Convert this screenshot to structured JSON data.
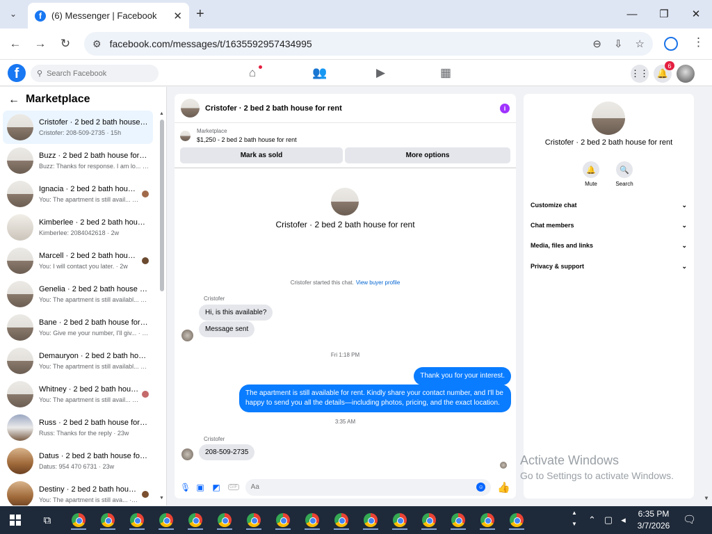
{
  "browser": {
    "tab_title": "(6) Messenger | Facebook",
    "url": "facebook.com/messages/t/1635592957434995",
    "new_tab": "+",
    "tab_close": "✕",
    "tab_search": "⌄",
    "window_min": "—",
    "window_restore": "❐",
    "window_close": "✕"
  },
  "facebook": {
    "search_placeholder": "Search Facebook",
    "notification_count": "6"
  },
  "left_panel": {
    "title": "Marketplace",
    "conversations": [
      {
        "name": "Cristofer · 2 bed 2 bath house f...",
        "preview": "Cristofer: 208-509-2735 · 15h"
      },
      {
        "name": "Buzz · 2 bed 2 bath house for r...",
        "preview": "Buzz: Thanks for response. I am lo... · 1w"
      },
      {
        "name": "Ignacia · 2 bed 2 bath house ...",
        "preview": "You: The apartment is still avail... · 1w"
      },
      {
        "name": "Kimberlee · 2 bed 2 bath house...",
        "preview": "Kimberlee: 2084042618 · 2w"
      },
      {
        "name": "Marcell · 2 bed 2 bath house ...",
        "preview": "You: I will contact you later. · 2w"
      },
      {
        "name": "Genelia · 2 bed 2 bath house fo...",
        "preview": "You: The apartment is still availabl... · 2w"
      },
      {
        "name": "Bane · 2 bed 2 bath house for r...",
        "preview": "You: Give me your number, I'll giv... · 4w"
      },
      {
        "name": "Demauryon · 2 bed 2 bath hou...",
        "preview": "You: The apartment is still availabl... · 4w"
      },
      {
        "name": "Whitney · 2 bed 2 bath hous...",
        "preview": "You: The apartment is still avail... · 4w"
      },
      {
        "name": "Russ · 2 bed 2 bath house for r...",
        "preview": "Russ: Thanks for the reply · 23w"
      },
      {
        "name": "Datus · 2 bed 2 bath house for ...",
        "preview": "Datus: 954 470 6731 · 23w"
      },
      {
        "name": "Destiny · 2 bed 2 bath house...",
        "preview": "You: The apartment is still ava... · 23w"
      }
    ]
  },
  "chat": {
    "title": "Cristofer · 2 bed 2 bath house for rent",
    "marketplace_label": "Marketplace",
    "listing": "$1,250 - 2 bed 2 bath house for rent",
    "mark_sold": "Mark as sold",
    "more_options": "More options",
    "started": "Cristofer started this chat.",
    "view_profile": "View buyer profile",
    "sender": "Cristofer",
    "msg1": "Hi, is this available?",
    "msg2": "Message sent",
    "stamp1": "Fri 1:18 PM",
    "out1": "Thank you for your interest.",
    "out2": "The apartment is still available for rent. Kindly share your contact number, and I'll be happy to send you all the details—including photos, pricing, and the exact location.",
    "stamp2": "3:35 AM",
    "msg3": "208-509-2735",
    "composer_placeholder": "Aa"
  },
  "right_panel": {
    "name": "Cristofer · 2 bed 2 bath house for rent",
    "mute": "Mute",
    "search": "Search",
    "sections": [
      "Customize chat",
      "Chat members",
      "Media, files and links",
      "Privacy & support"
    ]
  },
  "watermark": {
    "line1": "Activate Windows",
    "line2": "Go to Settings to activate Windows."
  },
  "taskbar": {
    "time": "6:35 PM",
    "date": "3/7/2026"
  },
  "colors": {
    "accent": "#1877f2",
    "outgoing_bubble": "#0a7cff",
    "badge": "#e41e3f"
  }
}
